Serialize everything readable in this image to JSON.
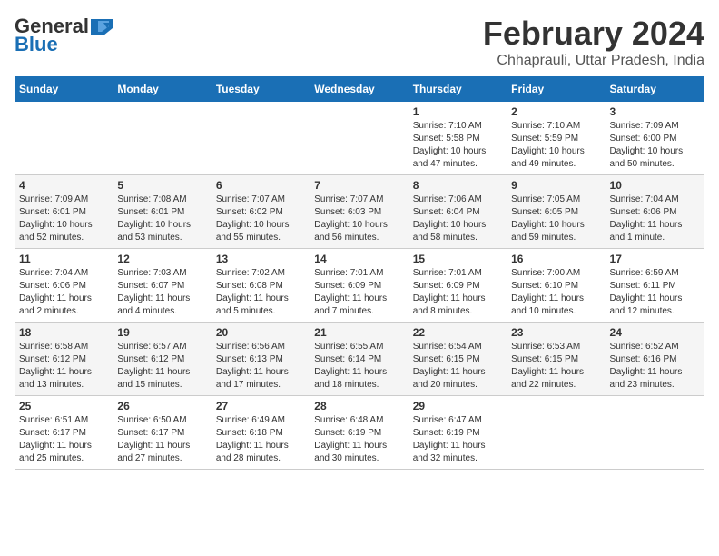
{
  "logo": {
    "part1": "General",
    "part2": "Blue"
  },
  "title": "February 2024",
  "location": "Chhaprauli, Uttar Pradesh, India",
  "headers": [
    "Sunday",
    "Monday",
    "Tuesday",
    "Wednesday",
    "Thursday",
    "Friday",
    "Saturday"
  ],
  "weeks": [
    [
      {
        "day": "",
        "info": ""
      },
      {
        "day": "",
        "info": ""
      },
      {
        "day": "",
        "info": ""
      },
      {
        "day": "",
        "info": ""
      },
      {
        "day": "1",
        "info": "Sunrise: 7:10 AM\nSunset: 5:58 PM\nDaylight: 10 hours\nand 47 minutes."
      },
      {
        "day": "2",
        "info": "Sunrise: 7:10 AM\nSunset: 5:59 PM\nDaylight: 10 hours\nand 49 minutes."
      },
      {
        "day": "3",
        "info": "Sunrise: 7:09 AM\nSunset: 6:00 PM\nDaylight: 10 hours\nand 50 minutes."
      }
    ],
    [
      {
        "day": "4",
        "info": "Sunrise: 7:09 AM\nSunset: 6:01 PM\nDaylight: 10 hours\nand 52 minutes."
      },
      {
        "day": "5",
        "info": "Sunrise: 7:08 AM\nSunset: 6:01 PM\nDaylight: 10 hours\nand 53 minutes."
      },
      {
        "day": "6",
        "info": "Sunrise: 7:07 AM\nSunset: 6:02 PM\nDaylight: 10 hours\nand 55 minutes."
      },
      {
        "day": "7",
        "info": "Sunrise: 7:07 AM\nSunset: 6:03 PM\nDaylight: 10 hours\nand 56 minutes."
      },
      {
        "day": "8",
        "info": "Sunrise: 7:06 AM\nSunset: 6:04 PM\nDaylight: 10 hours\nand 58 minutes."
      },
      {
        "day": "9",
        "info": "Sunrise: 7:05 AM\nSunset: 6:05 PM\nDaylight: 10 hours\nand 59 minutes."
      },
      {
        "day": "10",
        "info": "Sunrise: 7:04 AM\nSunset: 6:06 PM\nDaylight: 11 hours\nand 1 minute."
      }
    ],
    [
      {
        "day": "11",
        "info": "Sunrise: 7:04 AM\nSunset: 6:06 PM\nDaylight: 11 hours\nand 2 minutes."
      },
      {
        "day": "12",
        "info": "Sunrise: 7:03 AM\nSunset: 6:07 PM\nDaylight: 11 hours\nand 4 minutes."
      },
      {
        "day": "13",
        "info": "Sunrise: 7:02 AM\nSunset: 6:08 PM\nDaylight: 11 hours\nand 5 minutes."
      },
      {
        "day": "14",
        "info": "Sunrise: 7:01 AM\nSunset: 6:09 PM\nDaylight: 11 hours\nand 7 minutes."
      },
      {
        "day": "15",
        "info": "Sunrise: 7:01 AM\nSunset: 6:09 PM\nDaylight: 11 hours\nand 8 minutes."
      },
      {
        "day": "16",
        "info": "Sunrise: 7:00 AM\nSunset: 6:10 PM\nDaylight: 11 hours\nand 10 minutes."
      },
      {
        "day": "17",
        "info": "Sunrise: 6:59 AM\nSunset: 6:11 PM\nDaylight: 11 hours\nand 12 minutes."
      }
    ],
    [
      {
        "day": "18",
        "info": "Sunrise: 6:58 AM\nSunset: 6:12 PM\nDaylight: 11 hours\nand 13 minutes."
      },
      {
        "day": "19",
        "info": "Sunrise: 6:57 AM\nSunset: 6:12 PM\nDaylight: 11 hours\nand 15 minutes."
      },
      {
        "day": "20",
        "info": "Sunrise: 6:56 AM\nSunset: 6:13 PM\nDaylight: 11 hours\nand 17 minutes."
      },
      {
        "day": "21",
        "info": "Sunrise: 6:55 AM\nSunset: 6:14 PM\nDaylight: 11 hours\nand 18 minutes."
      },
      {
        "day": "22",
        "info": "Sunrise: 6:54 AM\nSunset: 6:15 PM\nDaylight: 11 hours\nand 20 minutes."
      },
      {
        "day": "23",
        "info": "Sunrise: 6:53 AM\nSunset: 6:15 PM\nDaylight: 11 hours\nand 22 minutes."
      },
      {
        "day": "24",
        "info": "Sunrise: 6:52 AM\nSunset: 6:16 PM\nDaylight: 11 hours\nand 23 minutes."
      }
    ],
    [
      {
        "day": "25",
        "info": "Sunrise: 6:51 AM\nSunset: 6:17 PM\nDaylight: 11 hours\nand 25 minutes."
      },
      {
        "day": "26",
        "info": "Sunrise: 6:50 AM\nSunset: 6:17 PM\nDaylight: 11 hours\nand 27 minutes."
      },
      {
        "day": "27",
        "info": "Sunrise: 6:49 AM\nSunset: 6:18 PM\nDaylight: 11 hours\nand 28 minutes."
      },
      {
        "day": "28",
        "info": "Sunrise: 6:48 AM\nSunset: 6:19 PM\nDaylight: 11 hours\nand 30 minutes."
      },
      {
        "day": "29",
        "info": "Sunrise: 6:47 AM\nSunset: 6:19 PM\nDaylight: 11 hours\nand 32 minutes."
      },
      {
        "day": "",
        "info": ""
      },
      {
        "day": "",
        "info": ""
      }
    ]
  ]
}
